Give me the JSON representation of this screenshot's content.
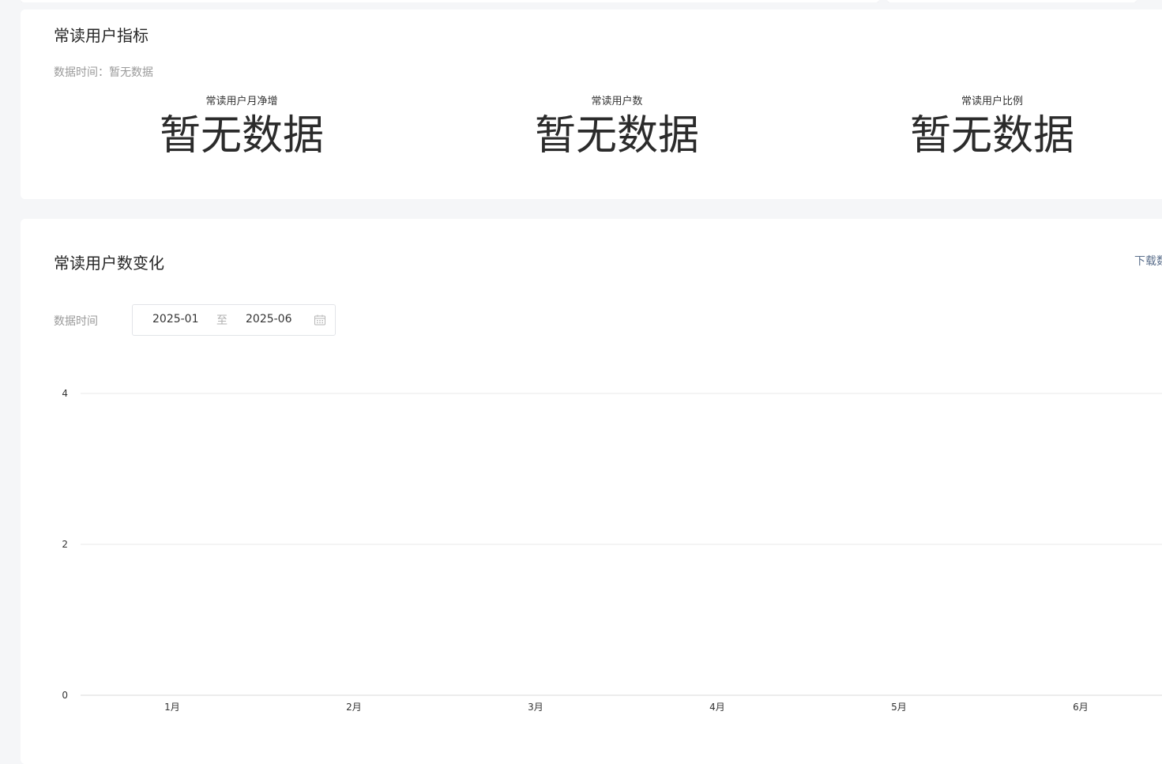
{
  "indicators_card": {
    "title": "常读用户指标",
    "data_time": "数据时间：暂无数据",
    "metrics": [
      {
        "label": "常读用户月净增",
        "value": "暂无数据"
      },
      {
        "label": "常读用户数",
        "value": "暂无数据"
      },
      {
        "label": "常读用户比例",
        "value": "暂无数据"
      }
    ]
  },
  "chart_card": {
    "title": "常读用户数变化",
    "download_label": "下载数",
    "range_label": "数据时间",
    "date_range": {
      "start": "2025-01",
      "separator": "至",
      "end": "2025-06"
    },
    "calendar_icon": "calendar-icon"
  },
  "chart_data": {
    "type": "line",
    "categories": [
      "1月",
      "2月",
      "3月",
      "4月",
      "5月",
      "6月"
    ],
    "series": [],
    "yticks": [
      0,
      2,
      4
    ],
    "ylim": [
      0,
      4
    ],
    "grid": true,
    "xlabel": "",
    "ylabel": "",
    "title": ""
  },
  "colors": {
    "background": "#f5f6f8",
    "card": "#ffffff",
    "gridline": "#e8e8e8",
    "axis_text": "#333333",
    "muted_text": "#9a9a9a",
    "link": "#5b6f8c"
  }
}
